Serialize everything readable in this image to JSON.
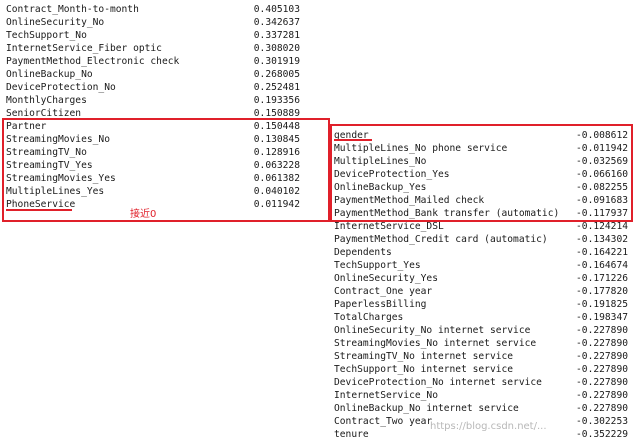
{
  "left_column": [
    {
      "feature": "Contract_Month-to-month",
      "value": "0.405103"
    },
    {
      "feature": "OnlineSecurity_No",
      "value": "0.342637"
    },
    {
      "feature": "TechSupport_No",
      "value": "0.337281"
    },
    {
      "feature": "InternetService_Fiber optic",
      "value": "0.308020"
    },
    {
      "feature": "PaymentMethod_Electronic check",
      "value": "0.301919"
    },
    {
      "feature": "OnlineBackup_No",
      "value": "0.268005"
    },
    {
      "feature": "DeviceProtection_No",
      "value": "0.252481"
    },
    {
      "feature": "MonthlyCharges",
      "value": "0.193356"
    },
    {
      "feature": "SeniorCitizen",
      "value": "0.150889"
    },
    {
      "feature": "Partner",
      "value": "0.150448"
    },
    {
      "feature": "StreamingMovies_No",
      "value": "0.130845"
    },
    {
      "feature": "StreamingTV_No",
      "value": "0.128916"
    },
    {
      "feature": "StreamingTV_Yes",
      "value": "0.063228"
    },
    {
      "feature": "StreamingMovies_Yes",
      "value": "0.061382"
    },
    {
      "feature": "MultipleLines_Yes",
      "value": "0.040102"
    },
    {
      "feature": "PhoneService",
      "value": "0.011942"
    }
  ],
  "right_column": [
    {
      "feature": "gender",
      "value": "-0.008612"
    },
    {
      "feature": "MultipleLines_No phone service",
      "value": "-0.011942"
    },
    {
      "feature": "MultipleLines_No",
      "value": "-0.032569"
    },
    {
      "feature": "DeviceProtection_Yes",
      "value": "-0.066160"
    },
    {
      "feature": "OnlineBackup_Yes",
      "value": "-0.082255"
    },
    {
      "feature": "PaymentMethod_Mailed check",
      "value": "-0.091683"
    },
    {
      "feature": "PaymentMethod_Bank transfer (automatic)",
      "value": "-0.117937"
    },
    {
      "feature": "InternetService_DSL",
      "value": "-0.124214"
    },
    {
      "feature": "PaymentMethod_Credit card (automatic)",
      "value": "-0.134302"
    },
    {
      "feature": "Dependents",
      "value": "-0.164221"
    },
    {
      "feature": "TechSupport_Yes",
      "value": "-0.164674"
    },
    {
      "feature": "OnlineSecurity_Yes",
      "value": "-0.171226"
    },
    {
      "feature": "Contract_One year",
      "value": "-0.177820"
    },
    {
      "feature": "PaperlessBilling",
      "value": "-0.191825"
    },
    {
      "feature": "TotalCharges",
      "value": "-0.198347"
    },
    {
      "feature": "OnlineSecurity_No internet service",
      "value": "-0.227890"
    },
    {
      "feature": "StreamingMovies_No internet service",
      "value": "-0.227890"
    },
    {
      "feature": "StreamingTV_No internet service",
      "value": "-0.227890"
    },
    {
      "feature": "TechSupport_No internet service",
      "value": "-0.227890"
    },
    {
      "feature": "DeviceProtection_No internet service",
      "value": "-0.227890"
    },
    {
      "feature": "InternetService_No",
      "value": "-0.227890"
    },
    {
      "feature": "OnlineBackup_No internet service",
      "value": "-0.227890"
    },
    {
      "feature": "Contract_Two year",
      "value": "-0.302253"
    },
    {
      "feature": "tenure",
      "value": "-0.352229"
    }
  ],
  "annotation_note": "接近0",
  "watermark": "https://blog.csdn.net/...",
  "colors": {
    "annotation": "#e0202a",
    "text": "#1a1a1a",
    "background": "#ffffff"
  }
}
